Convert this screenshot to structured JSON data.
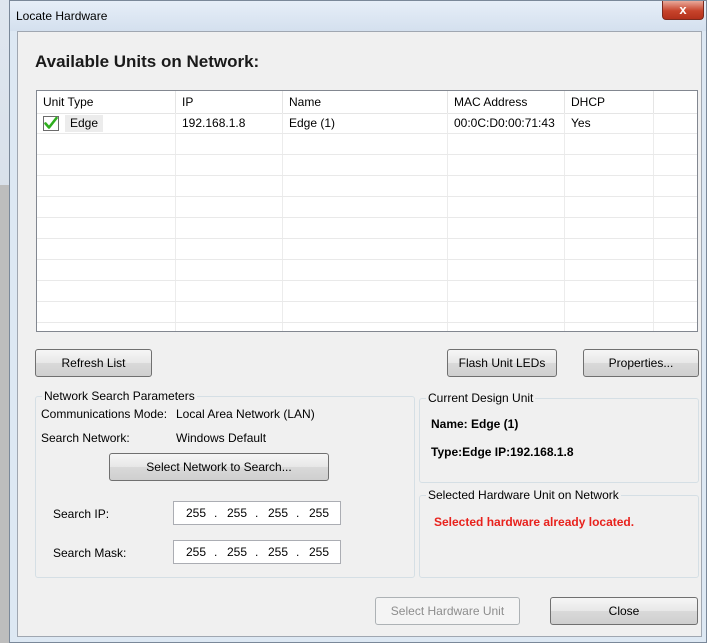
{
  "window": {
    "title": "Locate Hardware",
    "close_glyph": "x"
  },
  "heading": "Available Units on Network:",
  "table": {
    "columns": [
      "Unit Type",
      "IP",
      "Name",
      "MAC Address",
      "DHCP"
    ],
    "rows": [
      {
        "unit_type": "Edge",
        "ip": "192.168.1.8",
        "name": "Edge (1)",
        "mac": "00:0C:D0:00:71:43",
        "dhcp": "Yes",
        "status_icon": "green-check-icon"
      }
    ]
  },
  "buttons": {
    "refresh": "Refresh List",
    "flash": "Flash Unit LEDs",
    "properties": "Properties...",
    "select_network": "Select Network to Search...",
    "select_hardware": "Select Hardware Unit",
    "close": "Close"
  },
  "network_search": {
    "title": "Network Search Parameters",
    "comm_mode_label": "Communications Mode:",
    "comm_mode_value": "Local Area Network (LAN)",
    "search_network_label": "Search Network:",
    "search_network_value": "Windows Default",
    "search_ip_label": "Search IP:",
    "search_ip": [
      "255",
      "255",
      "255",
      "255"
    ],
    "search_mask_label": "Search Mask:",
    "search_mask": [
      "255",
      "255",
      "255",
      "255"
    ]
  },
  "current_design": {
    "title": "Current Design Unit",
    "name_line": "Name: Edge (1)",
    "type_line": "Type:Edge IP:192.168.1.8"
  },
  "selected_hw": {
    "title": "Selected Hardware Unit on Network",
    "message": "Selected hardware already located."
  },
  "colors": {
    "error_text": "#e8221d",
    "check_green": "#2fae1f"
  }
}
